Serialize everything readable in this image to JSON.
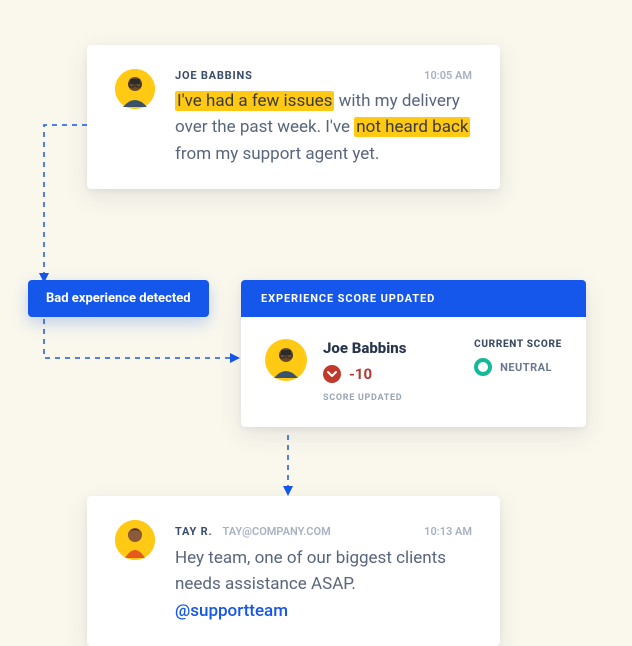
{
  "message1": {
    "author": "JOE BABBINS",
    "time": "10:05 AM",
    "body_pre": "",
    "hl1": "I've had a few issues",
    "body_mid": " with my delivery over the past week. I've ",
    "hl2": "not heard back",
    "body_post": " from my support agent yet."
  },
  "detection": {
    "label": "Bad experience detected"
  },
  "score_card": {
    "header": "EXPERIENCE SCORE UPDATED",
    "name": "Joe Babbins",
    "delta": "-10",
    "delta_direction": "down",
    "sub": "SCORE UPDATED",
    "current_label": "CURRENT SCORE",
    "current_value": "NEUTRAL"
  },
  "message2": {
    "author": "TAY R.",
    "email": "TAY@COMPANY.COM",
    "time": "10:13 AM",
    "body_pre": "Hey team, one of our biggest clients needs assistance ASAP. ",
    "mention": "@supportteam"
  },
  "colors": {
    "primary": "#1657eb",
    "highlight": "#ffc914",
    "negative": "#b23a35",
    "neutral": "#14b89a"
  }
}
